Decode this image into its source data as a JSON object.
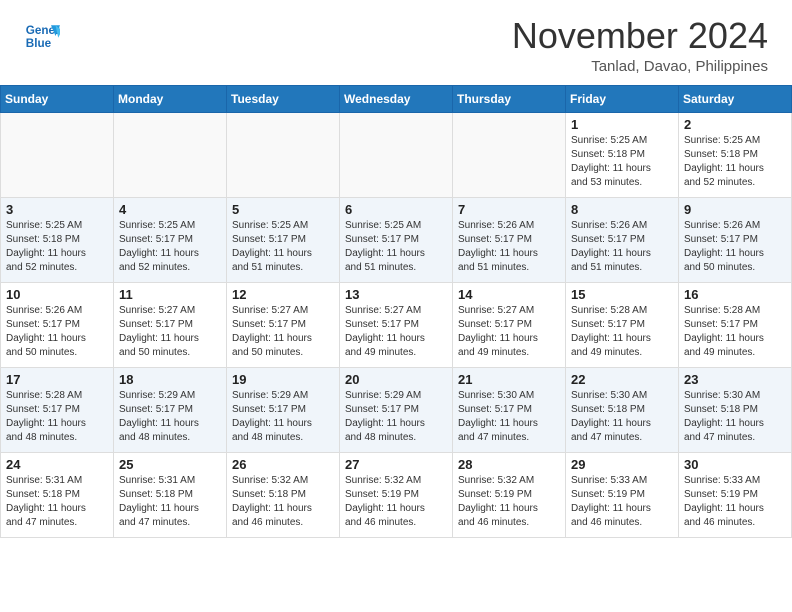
{
  "logo": {
    "line1": "General",
    "line2": "Blue"
  },
  "title": "November 2024",
  "location": "Tanlad, Davao, Philippines",
  "days_header": [
    "Sunday",
    "Monday",
    "Tuesday",
    "Wednesday",
    "Thursday",
    "Friday",
    "Saturday"
  ],
  "weeks": [
    [
      {
        "day": "",
        "info": ""
      },
      {
        "day": "",
        "info": ""
      },
      {
        "day": "",
        "info": ""
      },
      {
        "day": "",
        "info": ""
      },
      {
        "day": "",
        "info": ""
      },
      {
        "day": "1",
        "info": "Sunrise: 5:25 AM\nSunset: 5:18 PM\nDaylight: 11 hours\nand 53 minutes."
      },
      {
        "day": "2",
        "info": "Sunrise: 5:25 AM\nSunset: 5:18 PM\nDaylight: 11 hours\nand 52 minutes."
      }
    ],
    [
      {
        "day": "3",
        "info": "Sunrise: 5:25 AM\nSunset: 5:18 PM\nDaylight: 11 hours\nand 52 minutes."
      },
      {
        "day": "4",
        "info": "Sunrise: 5:25 AM\nSunset: 5:17 PM\nDaylight: 11 hours\nand 52 minutes."
      },
      {
        "day": "5",
        "info": "Sunrise: 5:25 AM\nSunset: 5:17 PM\nDaylight: 11 hours\nand 51 minutes."
      },
      {
        "day": "6",
        "info": "Sunrise: 5:25 AM\nSunset: 5:17 PM\nDaylight: 11 hours\nand 51 minutes."
      },
      {
        "day": "7",
        "info": "Sunrise: 5:26 AM\nSunset: 5:17 PM\nDaylight: 11 hours\nand 51 minutes."
      },
      {
        "day": "8",
        "info": "Sunrise: 5:26 AM\nSunset: 5:17 PM\nDaylight: 11 hours\nand 51 minutes."
      },
      {
        "day": "9",
        "info": "Sunrise: 5:26 AM\nSunset: 5:17 PM\nDaylight: 11 hours\nand 50 minutes."
      }
    ],
    [
      {
        "day": "10",
        "info": "Sunrise: 5:26 AM\nSunset: 5:17 PM\nDaylight: 11 hours\nand 50 minutes."
      },
      {
        "day": "11",
        "info": "Sunrise: 5:27 AM\nSunset: 5:17 PM\nDaylight: 11 hours\nand 50 minutes."
      },
      {
        "day": "12",
        "info": "Sunrise: 5:27 AM\nSunset: 5:17 PM\nDaylight: 11 hours\nand 50 minutes."
      },
      {
        "day": "13",
        "info": "Sunrise: 5:27 AM\nSunset: 5:17 PM\nDaylight: 11 hours\nand 49 minutes."
      },
      {
        "day": "14",
        "info": "Sunrise: 5:27 AM\nSunset: 5:17 PM\nDaylight: 11 hours\nand 49 minutes."
      },
      {
        "day": "15",
        "info": "Sunrise: 5:28 AM\nSunset: 5:17 PM\nDaylight: 11 hours\nand 49 minutes."
      },
      {
        "day": "16",
        "info": "Sunrise: 5:28 AM\nSunset: 5:17 PM\nDaylight: 11 hours\nand 49 minutes."
      }
    ],
    [
      {
        "day": "17",
        "info": "Sunrise: 5:28 AM\nSunset: 5:17 PM\nDaylight: 11 hours\nand 48 minutes."
      },
      {
        "day": "18",
        "info": "Sunrise: 5:29 AM\nSunset: 5:17 PM\nDaylight: 11 hours\nand 48 minutes."
      },
      {
        "day": "19",
        "info": "Sunrise: 5:29 AM\nSunset: 5:17 PM\nDaylight: 11 hours\nand 48 minutes."
      },
      {
        "day": "20",
        "info": "Sunrise: 5:29 AM\nSunset: 5:17 PM\nDaylight: 11 hours\nand 48 minutes."
      },
      {
        "day": "21",
        "info": "Sunrise: 5:30 AM\nSunset: 5:17 PM\nDaylight: 11 hours\nand 47 minutes."
      },
      {
        "day": "22",
        "info": "Sunrise: 5:30 AM\nSunset: 5:18 PM\nDaylight: 11 hours\nand 47 minutes."
      },
      {
        "day": "23",
        "info": "Sunrise: 5:30 AM\nSunset: 5:18 PM\nDaylight: 11 hours\nand 47 minutes."
      }
    ],
    [
      {
        "day": "24",
        "info": "Sunrise: 5:31 AM\nSunset: 5:18 PM\nDaylight: 11 hours\nand 47 minutes."
      },
      {
        "day": "25",
        "info": "Sunrise: 5:31 AM\nSunset: 5:18 PM\nDaylight: 11 hours\nand 47 minutes."
      },
      {
        "day": "26",
        "info": "Sunrise: 5:32 AM\nSunset: 5:18 PM\nDaylight: 11 hours\nand 46 minutes."
      },
      {
        "day": "27",
        "info": "Sunrise: 5:32 AM\nSunset: 5:19 PM\nDaylight: 11 hours\nand 46 minutes."
      },
      {
        "day": "28",
        "info": "Sunrise: 5:32 AM\nSunset: 5:19 PM\nDaylight: 11 hours\nand 46 minutes."
      },
      {
        "day": "29",
        "info": "Sunrise: 5:33 AM\nSunset: 5:19 PM\nDaylight: 11 hours\nand 46 minutes."
      },
      {
        "day": "30",
        "info": "Sunrise: 5:33 AM\nSunset: 5:19 PM\nDaylight: 11 hours\nand 46 minutes."
      }
    ]
  ]
}
